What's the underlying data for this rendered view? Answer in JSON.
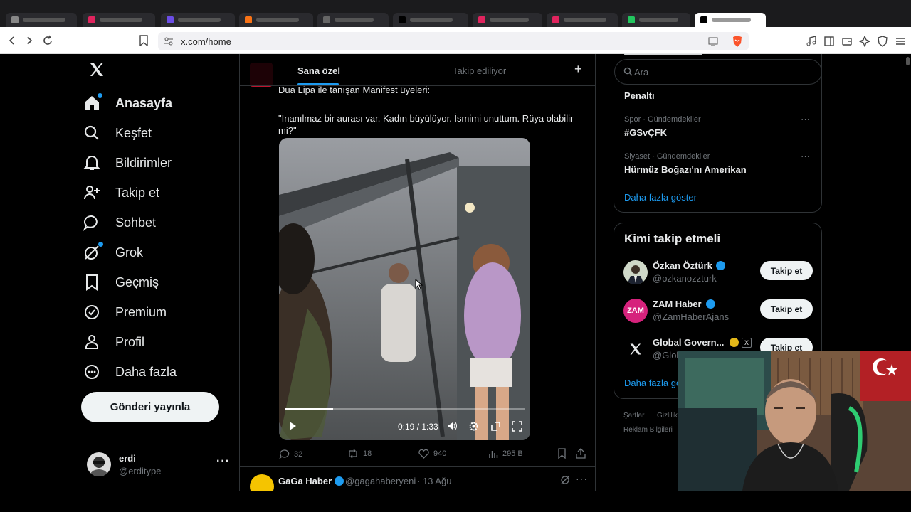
{
  "browser": {
    "url": "x.com/home"
  },
  "nav": {
    "items": [
      {
        "label": "Anasayfa",
        "icon": "home-icon",
        "bold": true
      },
      {
        "label": "Keşfet",
        "icon": "search-icon"
      },
      {
        "label": "Bildirimler",
        "icon": "bell-icon"
      },
      {
        "label": "Takip et",
        "icon": "follow-icon"
      },
      {
        "label": "Sohbet",
        "icon": "chat-icon"
      },
      {
        "label": "Grok",
        "icon": "grok-icon"
      },
      {
        "label": "Geçmiş",
        "icon": "bookmark-icon"
      },
      {
        "label": "Premium",
        "icon": "verified-icon"
      },
      {
        "label": "Profil",
        "icon": "person-icon"
      },
      {
        "label": "Daha fazla",
        "icon": "more-circle-icon"
      }
    ],
    "post_button": "Gönderi yayınla",
    "profile": {
      "name": "erdi",
      "handle": "@erditype"
    }
  },
  "feed": {
    "tabs": [
      "Sana özel",
      "Takip ediliyor"
    ],
    "add_tab": "+",
    "tweet": {
      "header_line": "Dua Lipa ile tanışan Manifest üyeleri:",
      "quote": "\"İnanılmaz bir aurası var. Kadın büyülüyor. İsmimi unuttum. Rüya olabilir mi?\"",
      "video_time": "0:19 / 1:33",
      "video_progress": 0.2,
      "replies": "32",
      "retweets": "18",
      "likes": "940",
      "views": "295 B"
    },
    "next_tweet": {
      "name": "GaGa Haber",
      "handle": "@gagahaberyeni",
      "date": "· 13 Ağu"
    }
  },
  "sidebar": {
    "search_placeholder": "Ara",
    "trends": [
      {
        "meta": "",
        "title": "Penaltı"
      },
      {
        "meta": "Spor · Gündemdekiler",
        "title": "#GSvÇFK"
      },
      {
        "meta": "Siyaset · Gündemdekiler",
        "title": "Hürmüz Boğazı'nı Amerikan"
      }
    ],
    "show_more": "Daha fazla göster",
    "who_to_follow": {
      "title": "Kimi takip etmeli",
      "users": [
        {
          "name": "Özkan Öztürk",
          "handle": "@ozkanozzturk",
          "button": "Takip et"
        },
        {
          "name": "ZAM Haber",
          "handle": "@ZamHaberAjans",
          "button": "Takip et",
          "avatar_text": "ZAM"
        },
        {
          "name": "Global Govern...",
          "handle": "@Glob",
          "button": "Takip et"
        }
      ],
      "show_more": "Daha fazla gös"
    },
    "footer": [
      "Şartlar",
      "Gizlilik",
      "Reklam Bilgileri"
    ]
  },
  "colors": {
    "accent": "#1d9bf0",
    "background": "#000000",
    "text": "#e7e9ea",
    "muted": "#71767b",
    "border": "#2f3336"
  }
}
